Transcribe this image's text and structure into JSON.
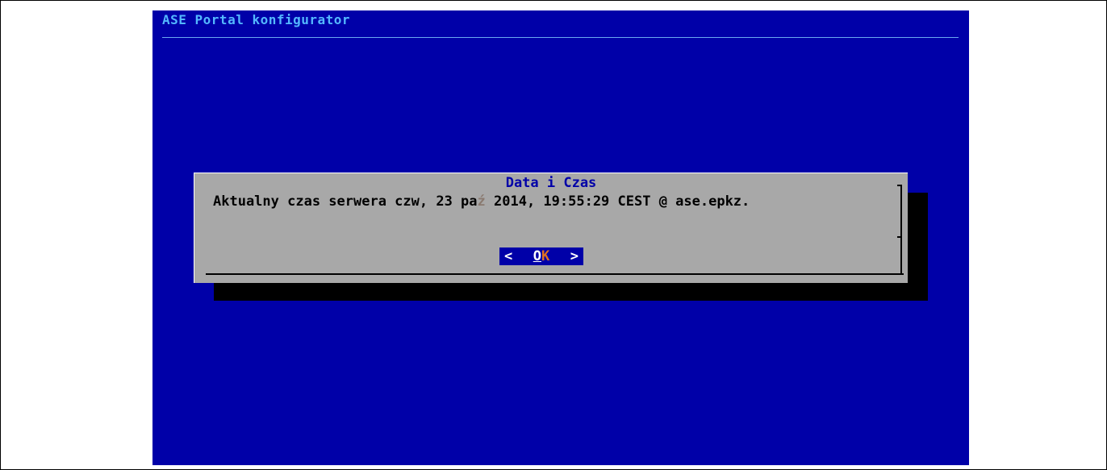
{
  "window": {
    "backtitle": "ASE Portal konfigurator"
  },
  "dialog": {
    "title": "Data i Czas",
    "message_before": "Aktualny czas serwera czw, 23 pa",
    "message_accent": "ź",
    "message_after": " 2014, 19:55:29 CEST @ ase.epkz.",
    "ok_button": {
      "left_arrow": "<",
      "hotkey": "O",
      "rest": "K",
      "right_arrow": ">"
    }
  },
  "colors": {
    "screen_background": "#0000a8",
    "backtitle": "#54b8ff",
    "dialog_background": "#a8a8a8",
    "dialog_title": "#0000a8",
    "button_background": "#0000a8",
    "button_accent": "#e07020"
  }
}
